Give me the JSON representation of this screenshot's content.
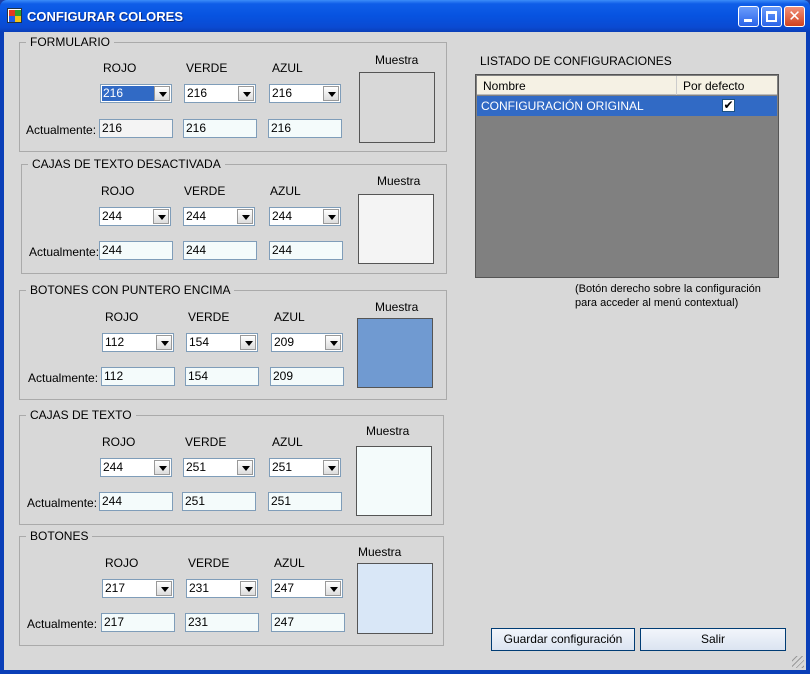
{
  "window": {
    "title": "CONFIGURAR COLORES"
  },
  "labels": {
    "rojo": "ROJO",
    "verde": "VERDE",
    "azul": "AZUL",
    "actual": "Actualmente:",
    "muestra": "Muestra"
  },
  "groups": [
    {
      "title": "FORMULARIO",
      "r": "216",
      "g": "216",
      "b": "216",
      "ar": "216",
      "ag": "216",
      "ab": "216",
      "swatch": "#d8d8d8"
    },
    {
      "title": "CAJAS DE TEXTO DESACTIVADA",
      "r": "244",
      "g": "244",
      "b": "244",
      "ar": "244",
      "ag": "244",
      "ab": "244",
      "swatch": "#f4f4f4"
    },
    {
      "title": "BOTONES CON PUNTERO ENCIMA",
      "r": "112",
      "g": "154",
      "b": "209",
      "ar": "112",
      "ag": "154",
      "ab": "209",
      "swatch": "#709ad1"
    },
    {
      "title": "CAJAS DE TEXTO",
      "r": "244",
      "g": "251",
      "b": "251",
      "ar": "244",
      "ag": "251",
      "ab": "251",
      "swatch": "#f4fbfb"
    },
    {
      "title": "BOTONES",
      "r": "217",
      "g": "231",
      "b": "247",
      "ar": "217",
      "ag": "231",
      "ab": "247",
      "swatch": "#d9e7f7"
    }
  ],
  "list": {
    "title": "LISTADO DE CONFIGURACIONES",
    "col_nombre": "Nombre",
    "col_defecto": "Por defecto",
    "rows": [
      {
        "nombre": "CONFIGURACIÓN ORIGINAL",
        "defecto": true
      }
    ],
    "hint_line1": "(Botón derecho sobre la configuración",
    "hint_line2": "para acceder al menú contextual)"
  },
  "buttons": {
    "guardar": "Guardar configuración",
    "salir": "Salir"
  },
  "colors": {
    "titlebar": "#0a4ad2",
    "form_bg": "#d8d8d8",
    "selection": "#316ac5",
    "list_bg": "#808080"
  }
}
